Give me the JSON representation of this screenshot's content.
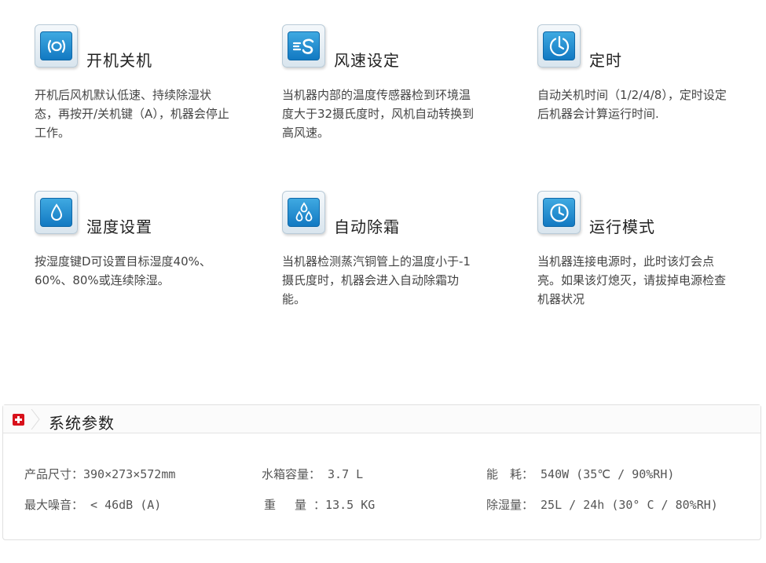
{
  "features": [
    {
      "icon": "power-icon",
      "title": "开机关机",
      "desc": "开机后风机默认低速、持续除湿状态，再按开/关机键（A），机器会停止工作。"
    },
    {
      "icon": "fan-speed-icon",
      "title": "风速设定",
      "desc": "当机器内部的温度传感器检到环境温度大于32摄氏度时，风机自动转换到高风速。"
    },
    {
      "icon": "timer-icon",
      "title": "定时",
      "desc": "自动关机时间（1/2/4/8），定时设定后机器会计算运行时间."
    },
    {
      "icon": "water-drop-icon",
      "title": "湿度设置",
      "desc": "按湿度键D可设置目标湿度40%、60%、80%或连续除湿。"
    },
    {
      "icon": "defrost-drops-icon",
      "title": "自动除霜",
      "desc": "当机器检测蒸汽铜管上的温度小于-1摄氏度时，机器会进入自动除霜功能。"
    },
    {
      "icon": "clock-icon",
      "title": "运行模式",
      "desc": "当机器连接电源时，此时该灯会点亮。如果该灯熄灭，请拔掉电源检查机器状况"
    }
  ],
  "params": {
    "title": "系统参数",
    "row1": {
      "size": "产品尺寸：390×273×572mm",
      "tank": "水箱容量： 3.7 L",
      "power": "能　耗： 540W (35℃ / 90%RH)"
    },
    "row2": {
      "noise": "最大噪音： < 46dB (A)",
      "weight": "重　 量 ：13.5 KG",
      "dehumid": "除湿量： 25L / 24h (30° C / 80%RH)"
    }
  },
  "colors": {
    "icon_blue": "#1b87cf",
    "badge_red": "#d8111b"
  }
}
